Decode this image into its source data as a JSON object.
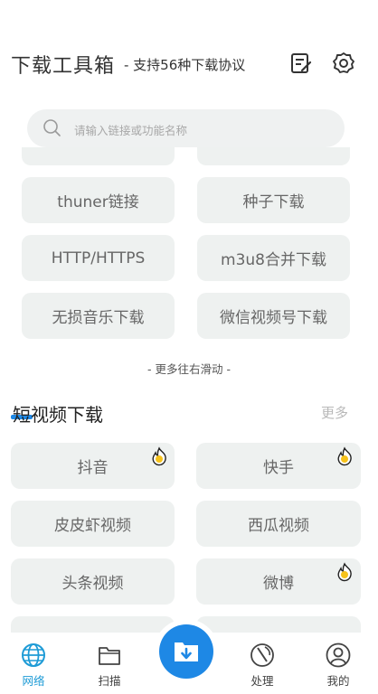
{
  "header": {
    "title": "下载工具箱",
    "subtitle": "- 支持56种下载协议"
  },
  "search": {
    "placeholder": "请输入链接或功能名称"
  },
  "tools": [
    "thuner链接",
    "种子下载",
    "HTTP/HTTPS",
    "m3u8合并下载",
    "无损音乐下载",
    "微信视频号下载"
  ],
  "scroll_hint": "- 更多往右滑动 -",
  "short_video": {
    "title": "短视频下载",
    "more": "更多",
    "items": [
      "抖音",
      "快手",
      "皮皮虾视频",
      "西瓜视频",
      "头条视频",
      "微博"
    ]
  },
  "tabbar": {
    "tabs": [
      "网络",
      "扫描",
      "处理",
      "我的"
    ]
  },
  "colors": {
    "accent": "#1e88e5",
    "active_tab": "#1e9bd6",
    "button_bg": "#eef1f0",
    "hot_badge": "#f6c21b"
  }
}
